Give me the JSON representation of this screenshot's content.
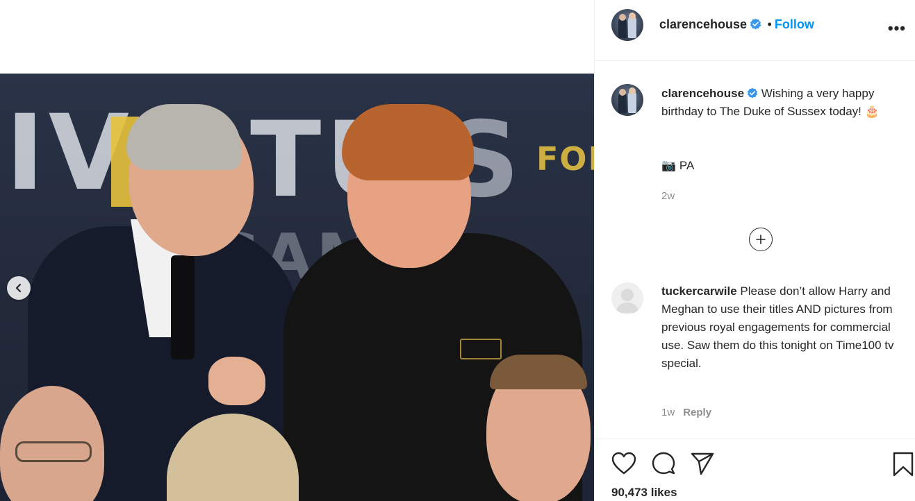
{
  "post": {
    "account": "clarencehouse",
    "follow_label": "Follow",
    "separator": "•",
    "more_label": "•••"
  },
  "caption": {
    "username": "clarencehouse",
    "text": "Wishing a very happy birthday to The Duke of Sussex today! 🎂",
    "credit": "📷 PA",
    "age": "2w"
  },
  "comments": [
    {
      "username": "tuckercarwile",
      "text": "Please don’t allow Harry and Meghan to use their titles AND pictures from previous royal engagements for commercial use. Saw them do this tonight on Time100 tv special.",
      "age": "1w",
      "reply_label": "Reply"
    }
  ],
  "photo": {
    "banner_words": [
      "IV",
      "TU",
      "S",
      "GAMES",
      "FOR"
    ]
  },
  "footer": {
    "likes": "90,473 likes"
  },
  "colors": {
    "accent": "#0095f6",
    "verified": "#3897f0",
    "muted": "#8e8e8e",
    "text": "#262626"
  },
  "icons": {
    "like": "heart-icon",
    "comment": "comment-icon",
    "share": "paper-plane-icon",
    "save": "bookmark-icon",
    "prev": "chevron-left-icon",
    "load_more": "plus-circle-icon",
    "more": "more-options-icon",
    "verified": "verified-badge-icon"
  }
}
